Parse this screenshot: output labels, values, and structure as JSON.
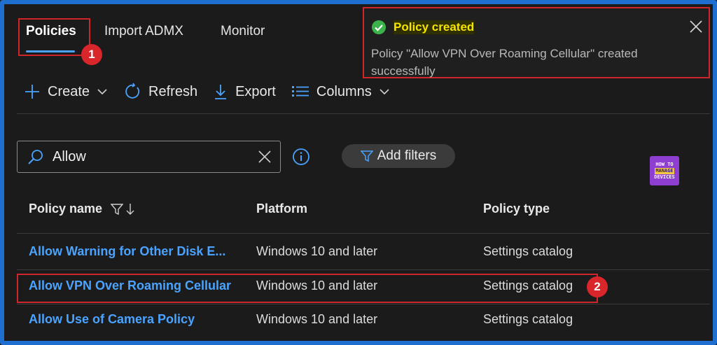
{
  "tabs": [
    {
      "label": "Policies",
      "active": true
    },
    {
      "label": "Import ADMX",
      "active": false
    },
    {
      "label": "Monitor",
      "active": false
    }
  ],
  "annotations": {
    "badge_1": "1",
    "badge_2": "2"
  },
  "toolbar": {
    "create_label": "Create",
    "refresh_label": "Refresh",
    "export_label": "Export",
    "columns_label": "Columns"
  },
  "search": {
    "value": "Allow"
  },
  "filters": {
    "label": "Add filters"
  },
  "logo": {
    "line1": "HOW TO",
    "line2": "MANAGE",
    "line3": "DEVICES"
  },
  "table": {
    "columns": [
      "Policy name",
      "Platform",
      "Policy type"
    ],
    "rows": [
      {
        "name": "Allow Warning for Other Disk E...",
        "platform": "Windows 10 and later",
        "type": "Settings catalog"
      },
      {
        "name": "Allow VPN Over Roaming Cellular",
        "platform": "Windows 10 and later",
        "type": "Settings catalog"
      },
      {
        "name": "Allow Use of Camera Policy",
        "platform": "Windows 10 and later",
        "type": "Settings catalog"
      }
    ]
  },
  "toast": {
    "title": "Policy created",
    "message": "Policy \"Allow VPN Over Roaming Cellular\" created successfully"
  },
  "colors": {
    "accent": "#4aa3ff",
    "highlight": "#d0262b",
    "success": "#3cb34a",
    "toast_title": "#f5e400"
  }
}
